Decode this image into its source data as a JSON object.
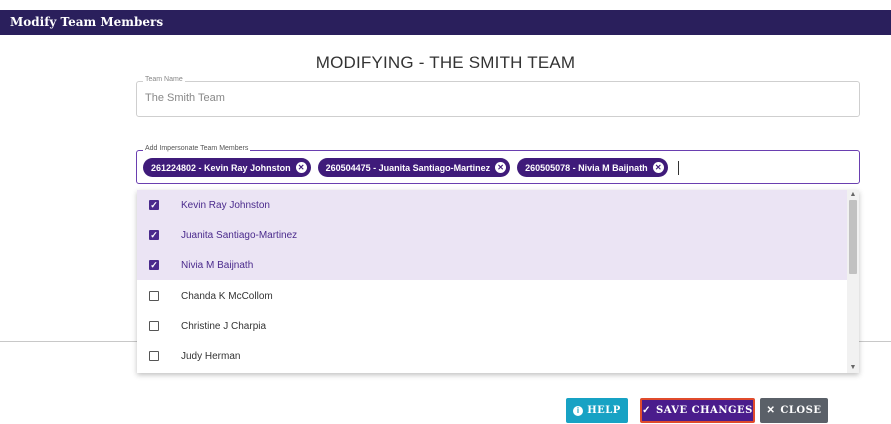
{
  "window": {
    "title": "Modify Team Members"
  },
  "heading": "MODIFYING - THE SMITH TEAM",
  "team_name": {
    "label": "Team Name",
    "value": "The Smith Team"
  },
  "members": {
    "label": "Add Impersonate Team Members",
    "chips": [
      {
        "text": "261224802 - Kevin Ray Johnston"
      },
      {
        "text": "260504475 - Juanita Santiago-Martinez"
      },
      {
        "text": "260505078 - Nivia M Baijnath"
      }
    ],
    "options": [
      {
        "name": "Kevin Ray Johnston",
        "checked": true
      },
      {
        "name": "Juanita Santiago-Martinez",
        "checked": true
      },
      {
        "name": "Nivia M Baijnath",
        "checked": true
      },
      {
        "name": "Chanda K McCollom",
        "checked": false
      },
      {
        "name": "Christine J Charpia",
        "checked": false
      },
      {
        "name": "Judy Herman",
        "checked": false
      }
    ]
  },
  "buttons": {
    "help": "HELP",
    "save": "SAVE CHANGES",
    "close": "CLOSE"
  },
  "colors": {
    "titlebar": "#2a1f5c",
    "chip": "#3f1b7a",
    "help": "#17a2c4",
    "save": "#4a1c8c",
    "save_outline": "#e04b2c",
    "close": "#5a6068"
  }
}
